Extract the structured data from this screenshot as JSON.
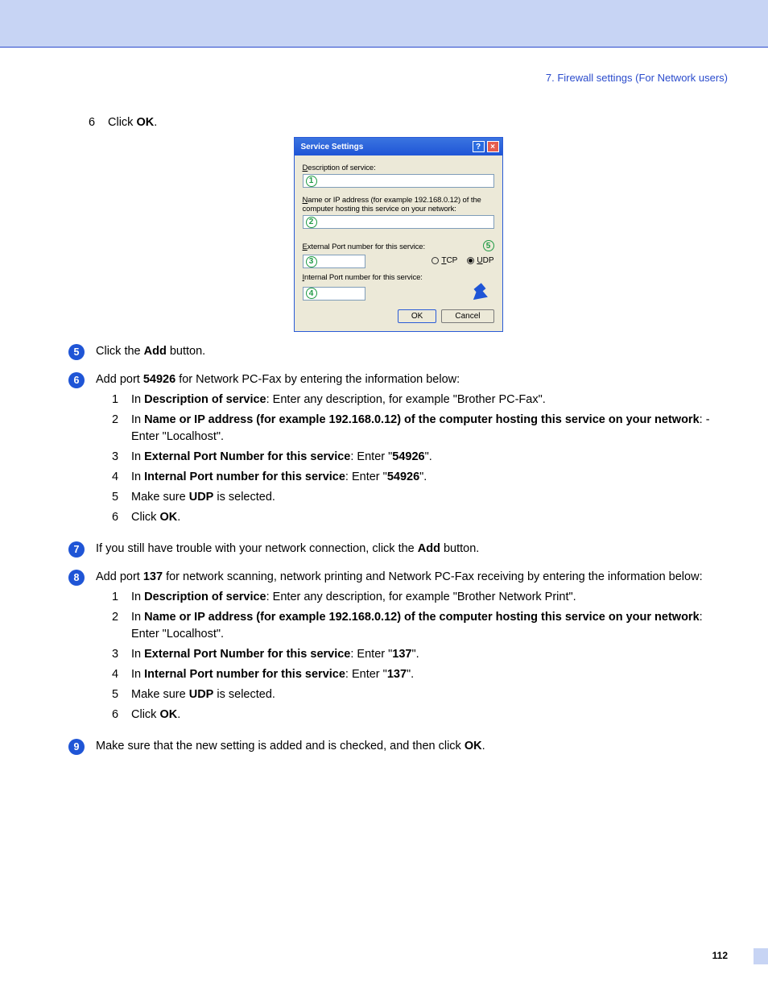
{
  "header": {
    "breadcrumb": "7. Firewall settings (For Network users)"
  },
  "intro_step": {
    "num": "6",
    "pre": "Click ",
    "bold": "OK",
    "post": "."
  },
  "dialog": {
    "title": "Service Settings",
    "help": "?",
    "close": "×",
    "desc_label": "Description of service:",
    "ip_label": "Name or IP address (for example 192.168.0.12) of the computer hosting this service on your network:",
    "ext_label": "External Port number for this service:",
    "int_label": "Internal Port number for this service:",
    "tcp": "TCP",
    "udp": "UDP",
    "ok": "OK",
    "cancel": "Cancel",
    "markers": {
      "m1": "1",
      "m2": "2",
      "m3": "3",
      "m4": "4",
      "m5": "5"
    }
  },
  "steps": {
    "s5": {
      "n": "5",
      "pre": "Click the ",
      "b1": "Add",
      "post": " button."
    },
    "s6": {
      "n": "6",
      "pre": "Add port ",
      "b1": "54926",
      "mid": " for Network PC-Fax by entering the information below:",
      "subs": [
        {
          "n": "1",
          "pre": "In ",
          "b": "Description of service",
          "post": ": Enter any description, for example \"Brother PC-Fax\"."
        },
        {
          "n": "2",
          "pre": "In ",
          "b": "Name or IP address (for example 192.168.0.12) of the computer hosting this service on your network",
          "post": ": - Enter \"Localhost\"."
        },
        {
          "n": "3",
          "pre": "In ",
          "b": "External Port Number for this service",
          "post": ": Enter \"",
          "b2": "54926",
          "post2": "\"."
        },
        {
          "n": "4",
          "pre": "In ",
          "b": "Internal Port number for this service",
          "post": ": Enter \"",
          "b2": "54926",
          "post2": "\"."
        },
        {
          "n": "5",
          "pre": "Make sure ",
          "b": "UDP",
          "post": " is selected."
        },
        {
          "n": "6",
          "pre": "Click ",
          "b": "OK",
          "post": "."
        }
      ]
    },
    "s7": {
      "n": "7",
      "pre": "If you still have trouble with your network connection, click the ",
      "b1": "Add",
      "post": " button."
    },
    "s8": {
      "n": "8",
      "pre": "Add port ",
      "b1": "137",
      "mid": " for network scanning, network printing and Network PC-Fax receiving by entering the information below:",
      "subs": [
        {
          "n": "1",
          "pre": "In ",
          "b": "Description of service",
          "post": ": Enter any description, for example \"Brother Network Print\"."
        },
        {
          "n": "2",
          "pre": "In ",
          "b": "Name or IP address (for example 192.168.0.12) of the computer hosting this service on your network",
          "post": ": Enter \"Localhost\"."
        },
        {
          "n": "3",
          "pre": "In ",
          "b": "External Port Number for this service",
          "post": ": Enter \"",
          "b2": "137",
          "post2": "\"."
        },
        {
          "n": "4",
          "pre": "In ",
          "b": "Internal Port number for this service",
          "post": ": Enter \"",
          "b2": "137",
          "post2": "\"."
        },
        {
          "n": "5",
          "pre": "Make sure ",
          "b": "UDP",
          "post": " is selected."
        },
        {
          "n": "6",
          "pre": "Click ",
          "b": "OK",
          "post": "."
        }
      ]
    },
    "s9": {
      "n": "9",
      "pre": "Make sure that the new setting is added and is checked, and then click ",
      "b1": "OK",
      "post": "."
    }
  },
  "page_number": "112"
}
